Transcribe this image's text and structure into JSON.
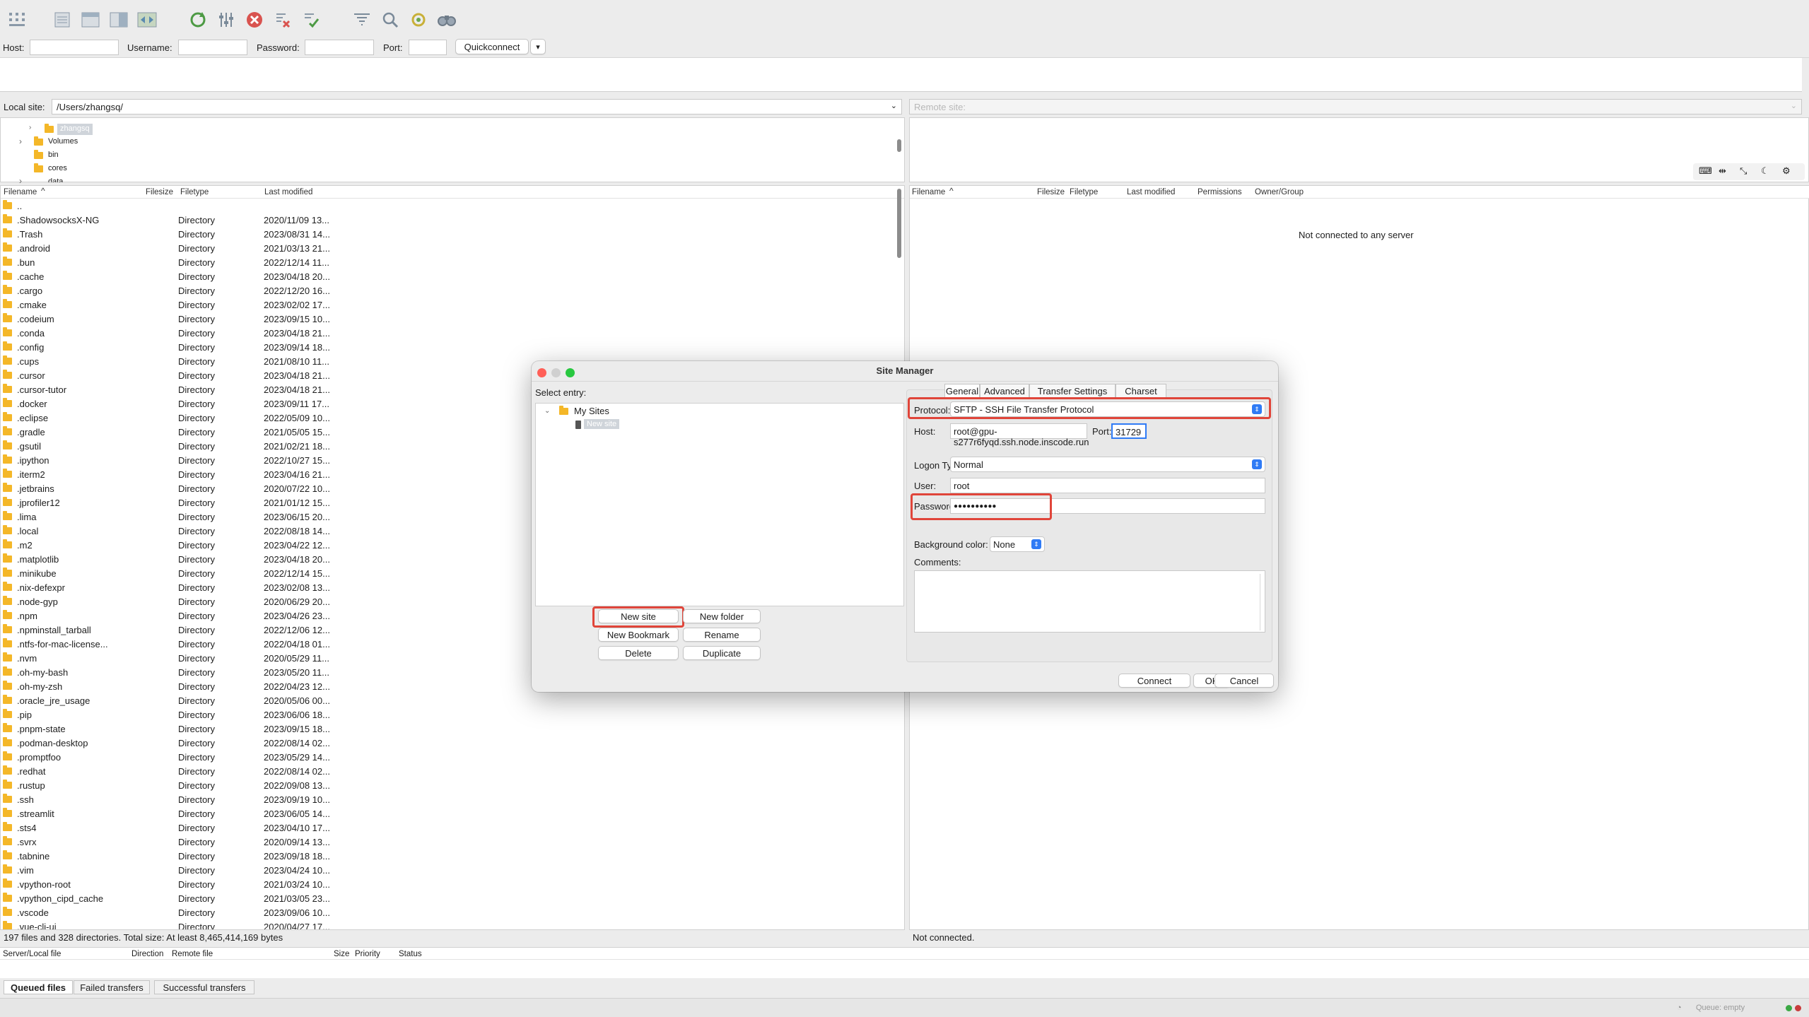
{
  "toolbar": {
    "icons": [
      "site-manager-icon",
      "toggle-log-icon",
      "toggle-local-tree-icon",
      "toggle-remote-tree-icon",
      "toggle-queue-icon",
      "refresh-icon",
      "filter-icon",
      "cancel-icon",
      "disconnect-icon",
      "reconnect-icon",
      "directory-listing-filters-icon",
      "search-icon",
      "sync-browse-icon",
      "find-files-icon"
    ]
  },
  "quickconnect": {
    "host_label": "Host:",
    "username_label": "Username:",
    "password_label": "Password:",
    "port_label": "Port:",
    "button_label": "Quickconnect",
    "dropdown_glyph": "▾"
  },
  "local": {
    "site_label": "Local site:",
    "path": "/Users/zhangsq/",
    "tree": [
      {
        "name": "zhangsq",
        "selected": true
      },
      {
        "name": "Volumes"
      },
      {
        "name": "bin"
      },
      {
        "name": "cores"
      },
      {
        "name": "data"
      }
    ],
    "columns": {
      "filename": "Filename",
      "filesize": "Filesize",
      "filetype": "Filetype",
      "modified": "Last modified"
    },
    "files": [
      {
        "name": "..",
        "type": "",
        "modified": ""
      },
      {
        "name": ".ShadowsocksX-NG",
        "type": "Directory",
        "modified": "2020/11/09 13..."
      },
      {
        "name": ".Trash",
        "type": "Directory",
        "modified": "2023/08/31 14..."
      },
      {
        "name": ".android",
        "type": "Directory",
        "modified": "2021/03/13 21..."
      },
      {
        "name": ".bun",
        "type": "Directory",
        "modified": "2022/12/14 11..."
      },
      {
        "name": ".cache",
        "type": "Directory",
        "modified": "2023/04/18 20..."
      },
      {
        "name": ".cargo",
        "type": "Directory",
        "modified": "2022/12/20 16..."
      },
      {
        "name": ".cmake",
        "type": "Directory",
        "modified": "2023/02/02 17..."
      },
      {
        "name": ".codeium",
        "type": "Directory",
        "modified": "2023/09/15 10..."
      },
      {
        "name": ".conda",
        "type": "Directory",
        "modified": "2023/04/18 21..."
      },
      {
        "name": ".config",
        "type": "Directory",
        "modified": "2023/09/14 18..."
      },
      {
        "name": ".cups",
        "type": "Directory",
        "modified": "2021/08/10 11..."
      },
      {
        "name": ".cursor",
        "type": "Directory",
        "modified": "2023/04/18 21..."
      },
      {
        "name": ".cursor-tutor",
        "type": "Directory",
        "modified": "2023/04/18 21..."
      },
      {
        "name": ".docker",
        "type": "Directory",
        "modified": "2023/09/11 17..."
      },
      {
        "name": ".eclipse",
        "type": "Directory",
        "modified": "2022/05/09 10..."
      },
      {
        "name": ".gradle",
        "type": "Directory",
        "modified": "2021/05/05 15..."
      },
      {
        "name": ".gsutil",
        "type": "Directory",
        "modified": "2021/02/21 18..."
      },
      {
        "name": ".ipython",
        "type": "Directory",
        "modified": "2022/10/27 15..."
      },
      {
        "name": ".iterm2",
        "type": "Directory",
        "modified": "2023/04/16 21..."
      },
      {
        "name": ".jetbrains",
        "type": "Directory",
        "modified": "2020/07/22 10..."
      },
      {
        "name": ".jprofiler12",
        "type": "Directory",
        "modified": "2021/01/12 15..."
      },
      {
        "name": ".lima",
        "type": "Directory",
        "modified": "2023/06/15 20..."
      },
      {
        "name": ".local",
        "type": "Directory",
        "modified": "2022/08/18 14..."
      },
      {
        "name": ".m2",
        "type": "Directory",
        "modified": "2023/04/22 12..."
      },
      {
        "name": ".matplotlib",
        "type": "Directory",
        "modified": "2023/04/18 20..."
      },
      {
        "name": ".minikube",
        "type": "Directory",
        "modified": "2022/12/14 15..."
      },
      {
        "name": ".nix-defexpr",
        "type": "Directory",
        "modified": "2023/02/08 13..."
      },
      {
        "name": ".node-gyp",
        "type": "Directory",
        "modified": "2020/06/29 20..."
      },
      {
        "name": ".npm",
        "type": "Directory",
        "modified": "2023/04/26 23..."
      },
      {
        "name": ".npminstall_tarball",
        "type": "Directory",
        "modified": "2022/12/06 12..."
      },
      {
        "name": ".ntfs-for-mac-license...",
        "type": "Directory",
        "modified": "2022/04/18 01..."
      },
      {
        "name": ".nvm",
        "type": "Directory",
        "modified": "2020/05/29 11..."
      },
      {
        "name": ".oh-my-bash",
        "type": "Directory",
        "modified": "2023/05/20 11..."
      },
      {
        "name": ".oh-my-zsh",
        "type": "Directory",
        "modified": "2022/04/23 12..."
      },
      {
        "name": ".oracle_jre_usage",
        "type": "Directory",
        "modified": "2020/05/06 00..."
      },
      {
        "name": ".pip",
        "type": "Directory",
        "modified": "2023/06/06 18..."
      },
      {
        "name": ".pnpm-state",
        "type": "Directory",
        "modified": "2023/09/15 18..."
      },
      {
        "name": ".podman-desktop",
        "type": "Directory",
        "modified": "2022/08/14 02..."
      },
      {
        "name": ".promptfoo",
        "type": "Directory",
        "modified": "2023/05/29 14..."
      },
      {
        "name": ".redhat",
        "type": "Directory",
        "modified": "2022/08/14 02..."
      },
      {
        "name": ".rustup",
        "type": "Directory",
        "modified": "2022/09/08 13..."
      },
      {
        "name": ".ssh",
        "type": "Directory",
        "modified": "2023/09/19 10..."
      },
      {
        "name": ".streamlit",
        "type": "Directory",
        "modified": "2023/06/05 14..."
      },
      {
        "name": ".sts4",
        "type": "Directory",
        "modified": "2023/04/10 17..."
      },
      {
        "name": ".svrx",
        "type": "Directory",
        "modified": "2020/09/14 13..."
      },
      {
        "name": ".tabnine",
        "type": "Directory",
        "modified": "2023/09/18 18..."
      },
      {
        "name": ".vim",
        "type": "Directory",
        "modified": "2023/04/24 10..."
      },
      {
        "name": ".vpython-root",
        "type": "Directory",
        "modified": "2021/03/24 10..."
      },
      {
        "name": ".vpython_cipd_cache",
        "type": "Directory",
        "modified": "2021/03/05 23..."
      },
      {
        "name": ".vscode",
        "type": "Directory",
        "modified": "2023/09/06 10..."
      },
      {
        "name": ".vue-cli-ui",
        "type": "Directory",
        "modified": "2020/04/27 17..."
      }
    ],
    "status": "197 files and 328 directories. Total size: At least 8,465,414,169 bytes"
  },
  "remote": {
    "site_label": "Remote site:",
    "columns": {
      "filename": "Filename",
      "filesize": "Filesize",
      "filetype": "Filetype",
      "modified": "Last modified",
      "permissions": "Permissions",
      "owner": "Owner/Group"
    },
    "empty_message": "Not connected to any server",
    "status": "Not connected."
  },
  "queue": {
    "columns": {
      "server": "Server/Local file",
      "direction": "Direction",
      "remote": "Remote file",
      "size": "Size",
      "priority": "Priority",
      "status": "Status"
    },
    "tabs": [
      "Queued files",
      "Failed transfers",
      "Successful transfers"
    ],
    "status": "Queue: empty"
  },
  "dialog": {
    "title": "Site Manager",
    "select_entry_label": "Select entry:",
    "tree": {
      "root": "My Sites",
      "child": "New site"
    },
    "tabs": [
      "General",
      "Advanced",
      "Transfer Settings",
      "Charset"
    ],
    "protocol_label": "Protocol:",
    "protocol_value": "SFTP - SSH File Transfer Protocol",
    "host_label": "Host:",
    "host_value": "root@gpu-s277r6fyqd.ssh.node.inscode.run",
    "port_label": "Port:",
    "port_value": "31729",
    "logon_label": "Logon Type:",
    "logon_value": "Normal",
    "user_label": "User:",
    "user_value": "root",
    "password_label": "Password:",
    "password_value": "●●●●●●●●●●",
    "bg_color_label": "Background color:",
    "bg_color_value": "None",
    "comments_label": "Comments:",
    "buttons": {
      "new_site": "New site",
      "new_folder": "New folder",
      "new_bookmark": "New Bookmark",
      "rename": "Rename",
      "delete": "Delete",
      "duplicate": "Duplicate",
      "connect": "Connect",
      "ok": "OK",
      "cancel": "Cancel"
    },
    "select_glyph": "⇕"
  },
  "colors": {
    "highlight": "#e0453a",
    "accent": "#2f7bf5",
    "folder": "#f4b728"
  }
}
